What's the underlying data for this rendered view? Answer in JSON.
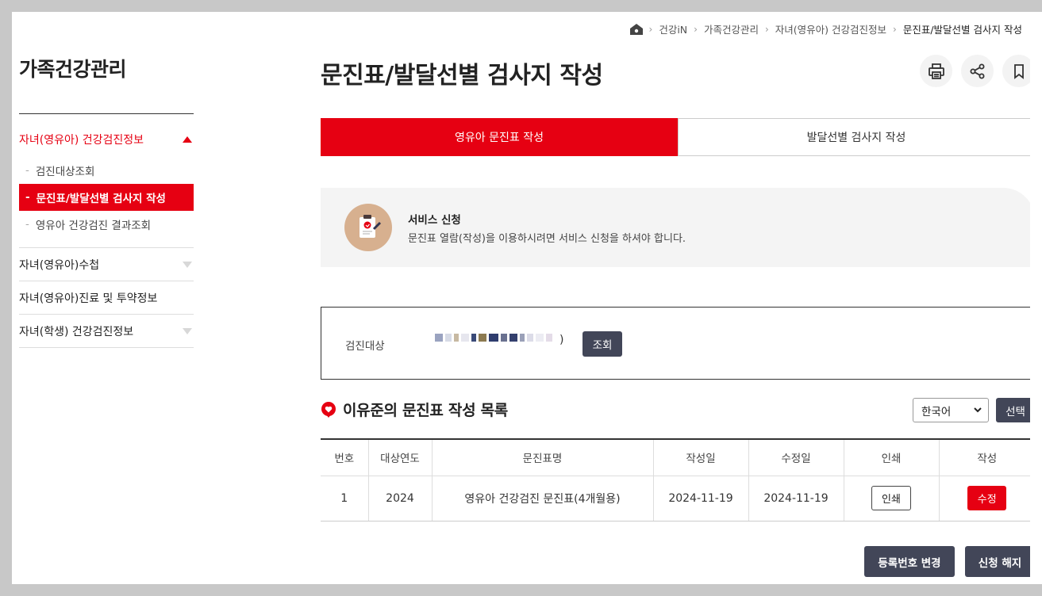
{
  "breadcrumb": [
    "건강iN",
    "가족건강관리",
    "자녀(영유아) 건강검진정보",
    "문진표/발달선별 검사지 작성"
  ],
  "sidebar": {
    "title": "가족건강관리",
    "groups": [
      {
        "label": "자녀(영유아) 건강검진정보",
        "expanded": true,
        "items": [
          {
            "label": "검진대상조회"
          },
          {
            "label": "문진표/발달선별 검사지 작성",
            "active": true
          },
          {
            "label": "영유아 건강검진 결과조회"
          }
        ]
      },
      {
        "label": "자녀(영유아)수첩"
      },
      {
        "label": "자녀(영유아)진료 및 투약정보"
      },
      {
        "label": "자녀(학생) 건강검진정보"
      }
    ]
  },
  "main": {
    "title": "문진표/발달선별 검사지 작성",
    "tools": [
      "print-icon",
      "share-icon",
      "bookmark-icon"
    ],
    "tabs": [
      {
        "label": "영유아 문진표 작성",
        "active": true
      },
      {
        "label": "발달선별 검사지 작성"
      }
    ],
    "notice": {
      "title": "서비스 신청",
      "desc": "문진표 열람(작성)을 이용하시려면 서비스 신청을 하셔야 합니다."
    },
    "search": {
      "label": "검진대상",
      "paren": ")",
      "button": "조회"
    },
    "list": {
      "title": "이유준의 문진표 작성 목록",
      "language": "한국어",
      "select_button": "선택",
      "columns": [
        "번호",
        "대상연도",
        "문진표명",
        "작성일",
        "수정일",
        "인쇄",
        "작성"
      ],
      "rows": [
        {
          "no": "1",
          "year": "2024",
          "name": "영유아 건강검진 문진표(4개월용)",
          "created": "2024-11-19",
          "modified": "2024-11-19",
          "print": "인쇄",
          "edit": "수정"
        }
      ]
    },
    "buttons": {
      "change_reg": "등록번호 변경",
      "cancel": "신청 해지"
    }
  },
  "colors": {
    "accent": "#e60012",
    "dark_button": "#424658",
    "notice_bg": "#f4f4f4"
  }
}
